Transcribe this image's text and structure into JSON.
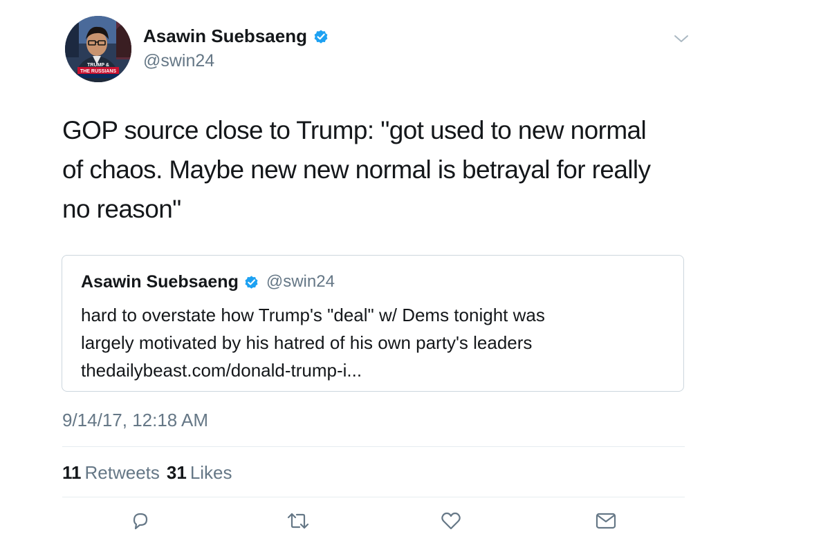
{
  "tweet": {
    "display_name": "Asawin Suebsaeng",
    "handle": "@swin24",
    "verified_icon": "verified-badge-icon",
    "caret_icon": "chevron-down-icon",
    "avatar_caption_line1": "TRUMP &",
    "avatar_caption_line2": "THE RUSSIANS",
    "text_lines": [
      "GOP source close to Trump: \"got used to new normal",
      "of chaos. Maybe new new normal is betrayal for really",
      "no reason\""
    ],
    "timestamp": "9/14/17, 12:18 AM"
  },
  "quoted": {
    "display_name": "Asawin Suebsaeng",
    "handle": "@swin24",
    "text_lines": [
      "hard to overstate how Trump's \"deal\" w/ Dems tonight was",
      "largely motivated by his hatred of his own party's leaders",
      "thedailybeast.com/donald-trump-i..."
    ]
  },
  "stats": {
    "retweets_count": "11",
    "retweets_label": "Retweets",
    "likes_count": "31",
    "likes_label": "Likes"
  },
  "actions": [
    {
      "name": "reply",
      "icon": "reply-icon"
    },
    {
      "name": "retweet",
      "icon": "retweet-icon"
    },
    {
      "name": "like",
      "icon": "heart-icon"
    },
    {
      "name": "direct-message",
      "icon": "envelope-icon"
    }
  ],
  "colors": {
    "text": "#14171a",
    "secondary": "#657786",
    "verified_blue": "#1da1f2",
    "border": "#ccd6dd",
    "divider": "#e6ecf0"
  }
}
